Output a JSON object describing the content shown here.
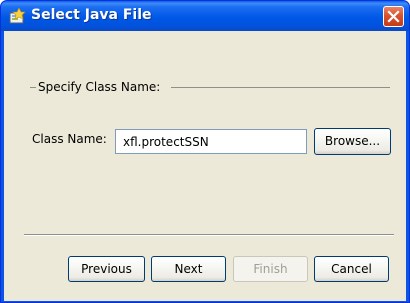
{
  "window": {
    "title": "Select Java File",
    "app_icon": "java-wizard-icon",
    "close_icon": "close-icon"
  },
  "group": {
    "title": "Specify Class Name:"
  },
  "class_name": {
    "label": "Class Name:",
    "value": "xfl.protectSSN"
  },
  "buttons": {
    "browse": "Browse...",
    "previous": "Previous",
    "next": "Next",
    "finish": "Finish",
    "cancel": "Cancel"
  },
  "colors": {
    "titlebar": "#0058e6",
    "client": "#ece9d8",
    "close_button": "#d8542f",
    "disabled_text": "#a19e92"
  }
}
